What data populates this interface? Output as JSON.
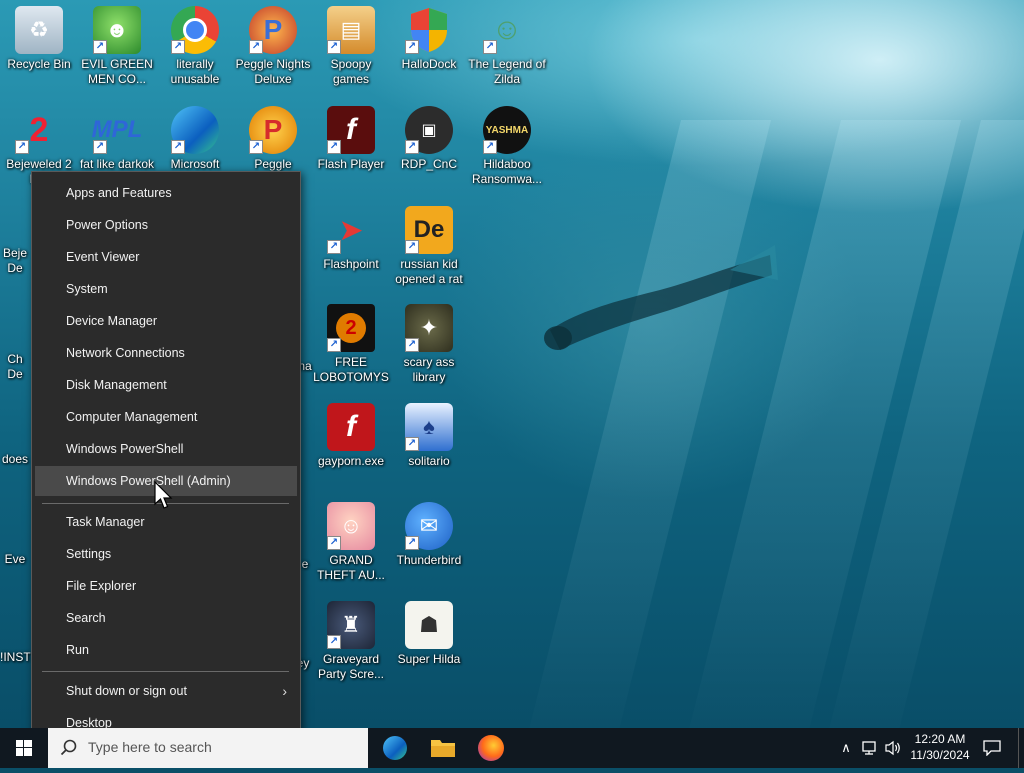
{
  "desktop_icons": [
    {
      "label": "Recycle Bin"
    },
    {
      "label": "EVIL GREEN MEN CO..."
    },
    {
      "label": "literally unusable"
    },
    {
      "label": "Peggle Nights Deluxe"
    },
    {
      "label": "Spoopy games"
    },
    {
      "label": "HalloDock"
    },
    {
      "label": "The Legend of Zilda"
    },
    {
      "label": "Bejeweled 2 D..."
    },
    {
      "label": "fat like darkok"
    },
    {
      "label": "Microsoft"
    },
    {
      "label": "Peggle World..."
    },
    {
      "label": "Flash Player"
    },
    {
      "label": "RDP_CnC"
    },
    {
      "label": "Hildaboo Ransomwa..."
    },
    {
      "label": "Flashpoint"
    },
    {
      "label": "russian kid opened a rat"
    },
    {
      "label": "FREE LOBOTOMYS"
    },
    {
      "label": "scary ass library"
    },
    {
      "label": "gayporn.exe"
    },
    {
      "label": "solitario"
    },
    {
      "label": "GRAND THEFT AU..."
    },
    {
      "label": "Thunderbird"
    },
    {
      "label": "Graveyard Party Scre..."
    },
    {
      "label": "Super Hilda"
    }
  ],
  "partial_labels": {
    "col1": [
      "Beje",
      "De",
      "Ch",
      "De",
      "does",
      "Eve",
      "!INST"
    ],
    "col4": [
      "na",
      "e",
      "ey"
    ]
  },
  "context_menu": {
    "group1": [
      "Apps and Features",
      "Power Options",
      "Event Viewer",
      "System",
      "Device Manager",
      "Network Connections",
      "Disk Management",
      "Computer Management",
      "Windows PowerShell",
      "Windows PowerShell (Admin)"
    ],
    "hovered": "Windows PowerShell (Admin)",
    "group2": [
      "Task Manager",
      "Settings",
      "File Explorer",
      "Search",
      "Run"
    ],
    "group3": [
      "Shut down or sign out",
      "Desktop"
    ]
  },
  "taskbar": {
    "search_placeholder": "Type here to search",
    "pinned": [
      "edge-icon",
      "file-explorer-icon",
      "firefox-icon"
    ],
    "time": "12:20 AM",
    "date": "11/30/2024"
  },
  "colors": {
    "menu_bg": "#2b2b2b",
    "menu_hover": "#4a4a4a",
    "taskbar_bg": "#101820"
  }
}
